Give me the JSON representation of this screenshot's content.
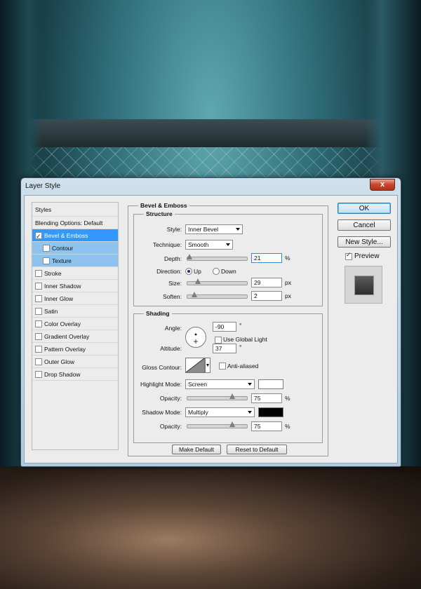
{
  "dialog": {
    "title": "Layer Style",
    "close_label": "x"
  },
  "left_panel": {
    "header": "Styles",
    "blending": "Blending Options: Default",
    "items": [
      {
        "label": "Bevel & Emboss",
        "checked": true
      },
      {
        "label": "Contour",
        "checked": false
      },
      {
        "label": "Texture",
        "checked": false
      },
      {
        "label": "Stroke",
        "checked": false
      },
      {
        "label": "Inner Shadow",
        "checked": false
      },
      {
        "label": "Inner Glow",
        "checked": false
      },
      {
        "label": "Satin",
        "checked": false
      },
      {
        "label": "Color Overlay",
        "checked": false
      },
      {
        "label": "Gradient Overlay",
        "checked": false
      },
      {
        "label": "Pattern Overlay",
        "checked": false
      },
      {
        "label": "Outer Glow",
        "checked": false
      },
      {
        "label": "Drop Shadow",
        "checked": false
      }
    ]
  },
  "bevel": {
    "section_title": "Bevel & Emboss",
    "structure_title": "Structure",
    "style_label": "Style:",
    "style_value": "Inner Bevel",
    "technique_label": "Technique:",
    "technique_value": "Smooth",
    "depth_label": "Depth:",
    "depth_value": "21",
    "depth_unit": "%",
    "direction_label": "Direction:",
    "direction_up": "Up",
    "direction_down": "Down",
    "direction_selected": "Up",
    "size_label": "Size:",
    "size_value": "29",
    "size_unit": "px",
    "soften_label": "Soften:",
    "soften_value": "2",
    "soften_unit": "px"
  },
  "shading": {
    "title": "Shading",
    "angle_label": "Angle:",
    "angle_value": "-90",
    "angle_unit": "°",
    "global_light_label": "Use Global Light",
    "global_light_checked": false,
    "altitude_label": "Altitude:",
    "altitude_value": "37",
    "altitude_unit": "°",
    "gloss_label": "Gloss Contour:",
    "anti_aliased_label": "Anti-aliased",
    "anti_aliased_checked": false,
    "highlight_mode_label": "Highlight Mode:",
    "highlight_mode_value": "Screen",
    "highlight_color": "#ffffff",
    "highlight_opacity_label": "Opacity:",
    "highlight_opacity_value": "75",
    "highlight_opacity_unit": "%",
    "shadow_mode_label": "Shadow Mode:",
    "shadow_mode_value": "Multiply",
    "shadow_color": "#000000",
    "shadow_opacity_label": "Opacity:",
    "shadow_opacity_value": "75",
    "shadow_opacity_unit": "%"
  },
  "buttons": {
    "ok": "OK",
    "cancel": "Cancel",
    "new_style": "New Style...",
    "preview_label": "Preview",
    "preview_checked": true,
    "make_default": "Make Default",
    "reset_default": "Reset to Default"
  },
  "colors": {
    "selection": "#3399ff",
    "sub_selection": "#8ec2ef"
  }
}
